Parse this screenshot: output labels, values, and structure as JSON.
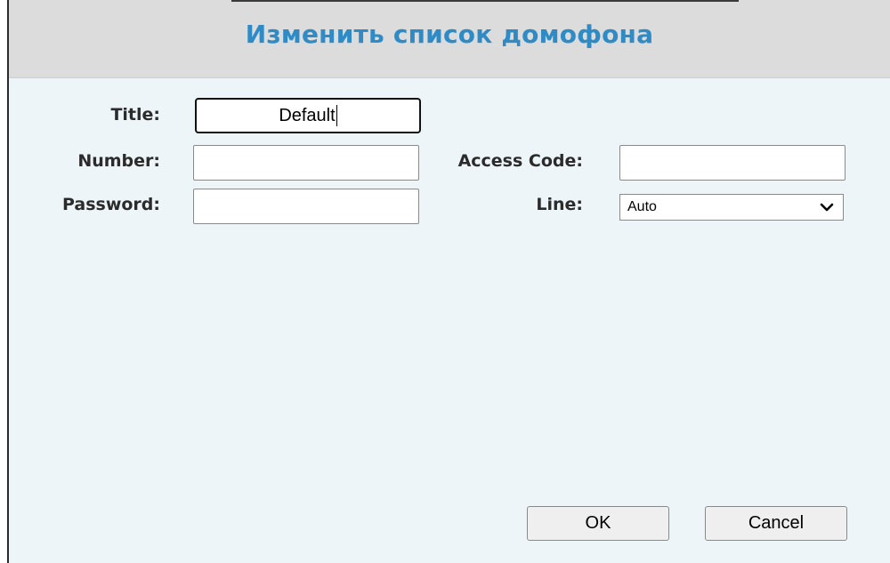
{
  "dialog": {
    "title": "Изменить список домофона"
  },
  "form": {
    "title_label": "Title:",
    "title_value": "Default",
    "number_label": "Number:",
    "number_value": "",
    "password_label": "Password:",
    "password_value": "",
    "access_code_label": "Access Code:",
    "access_code_value": "",
    "line_label": "Line:",
    "line_selected": "Auto"
  },
  "buttons": {
    "ok": "OK",
    "cancel": "Cancel"
  },
  "colors": {
    "title": "#2e8bc6",
    "header_bg": "#dcdcdc",
    "body_bg": "#eef5f8"
  }
}
